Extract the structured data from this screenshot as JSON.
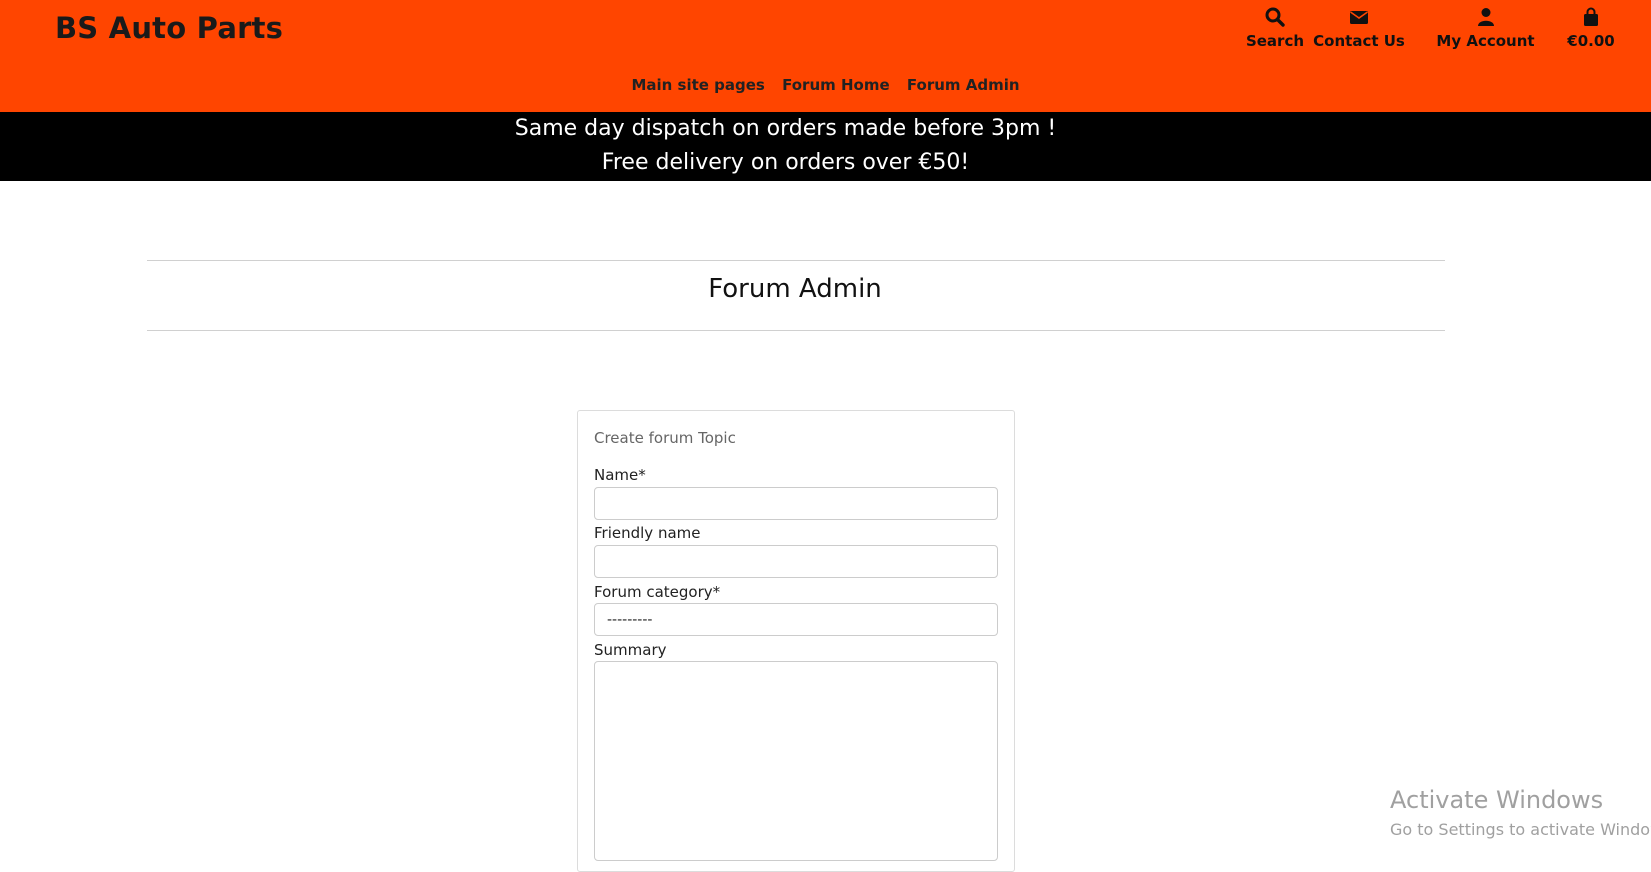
{
  "header": {
    "brand": "BS Auto Parts",
    "nav": {
      "search": "Search",
      "contact": "Contact Us",
      "account": "My Account",
      "cart": "€0.00"
    },
    "subnav": [
      "Main site pages",
      "Forum Home",
      "Forum Admin"
    ]
  },
  "banner": {
    "line1": "Same day dispatch on orders made before 3pm !",
    "line2": "Free delivery on orders over €50!"
  },
  "page": {
    "title": "Forum Admin"
  },
  "form": {
    "title": "Create forum Topic",
    "name_label": "Name*",
    "name_value": "",
    "friendly_label": "Friendly name",
    "friendly_value": "",
    "category_label": "Forum category*",
    "category_value": "---------",
    "summary_label": "Summary",
    "summary_value": ""
  },
  "watermark": {
    "line1": "Activate Windows",
    "line2": "Go to Settings to activate Windows."
  },
  "colors": {
    "header": "#ff4500",
    "banner": "#000000",
    "text": "#222222"
  },
  "icons": [
    "search-icon",
    "envelope-icon",
    "user-icon",
    "shopping-bag-icon"
  ]
}
